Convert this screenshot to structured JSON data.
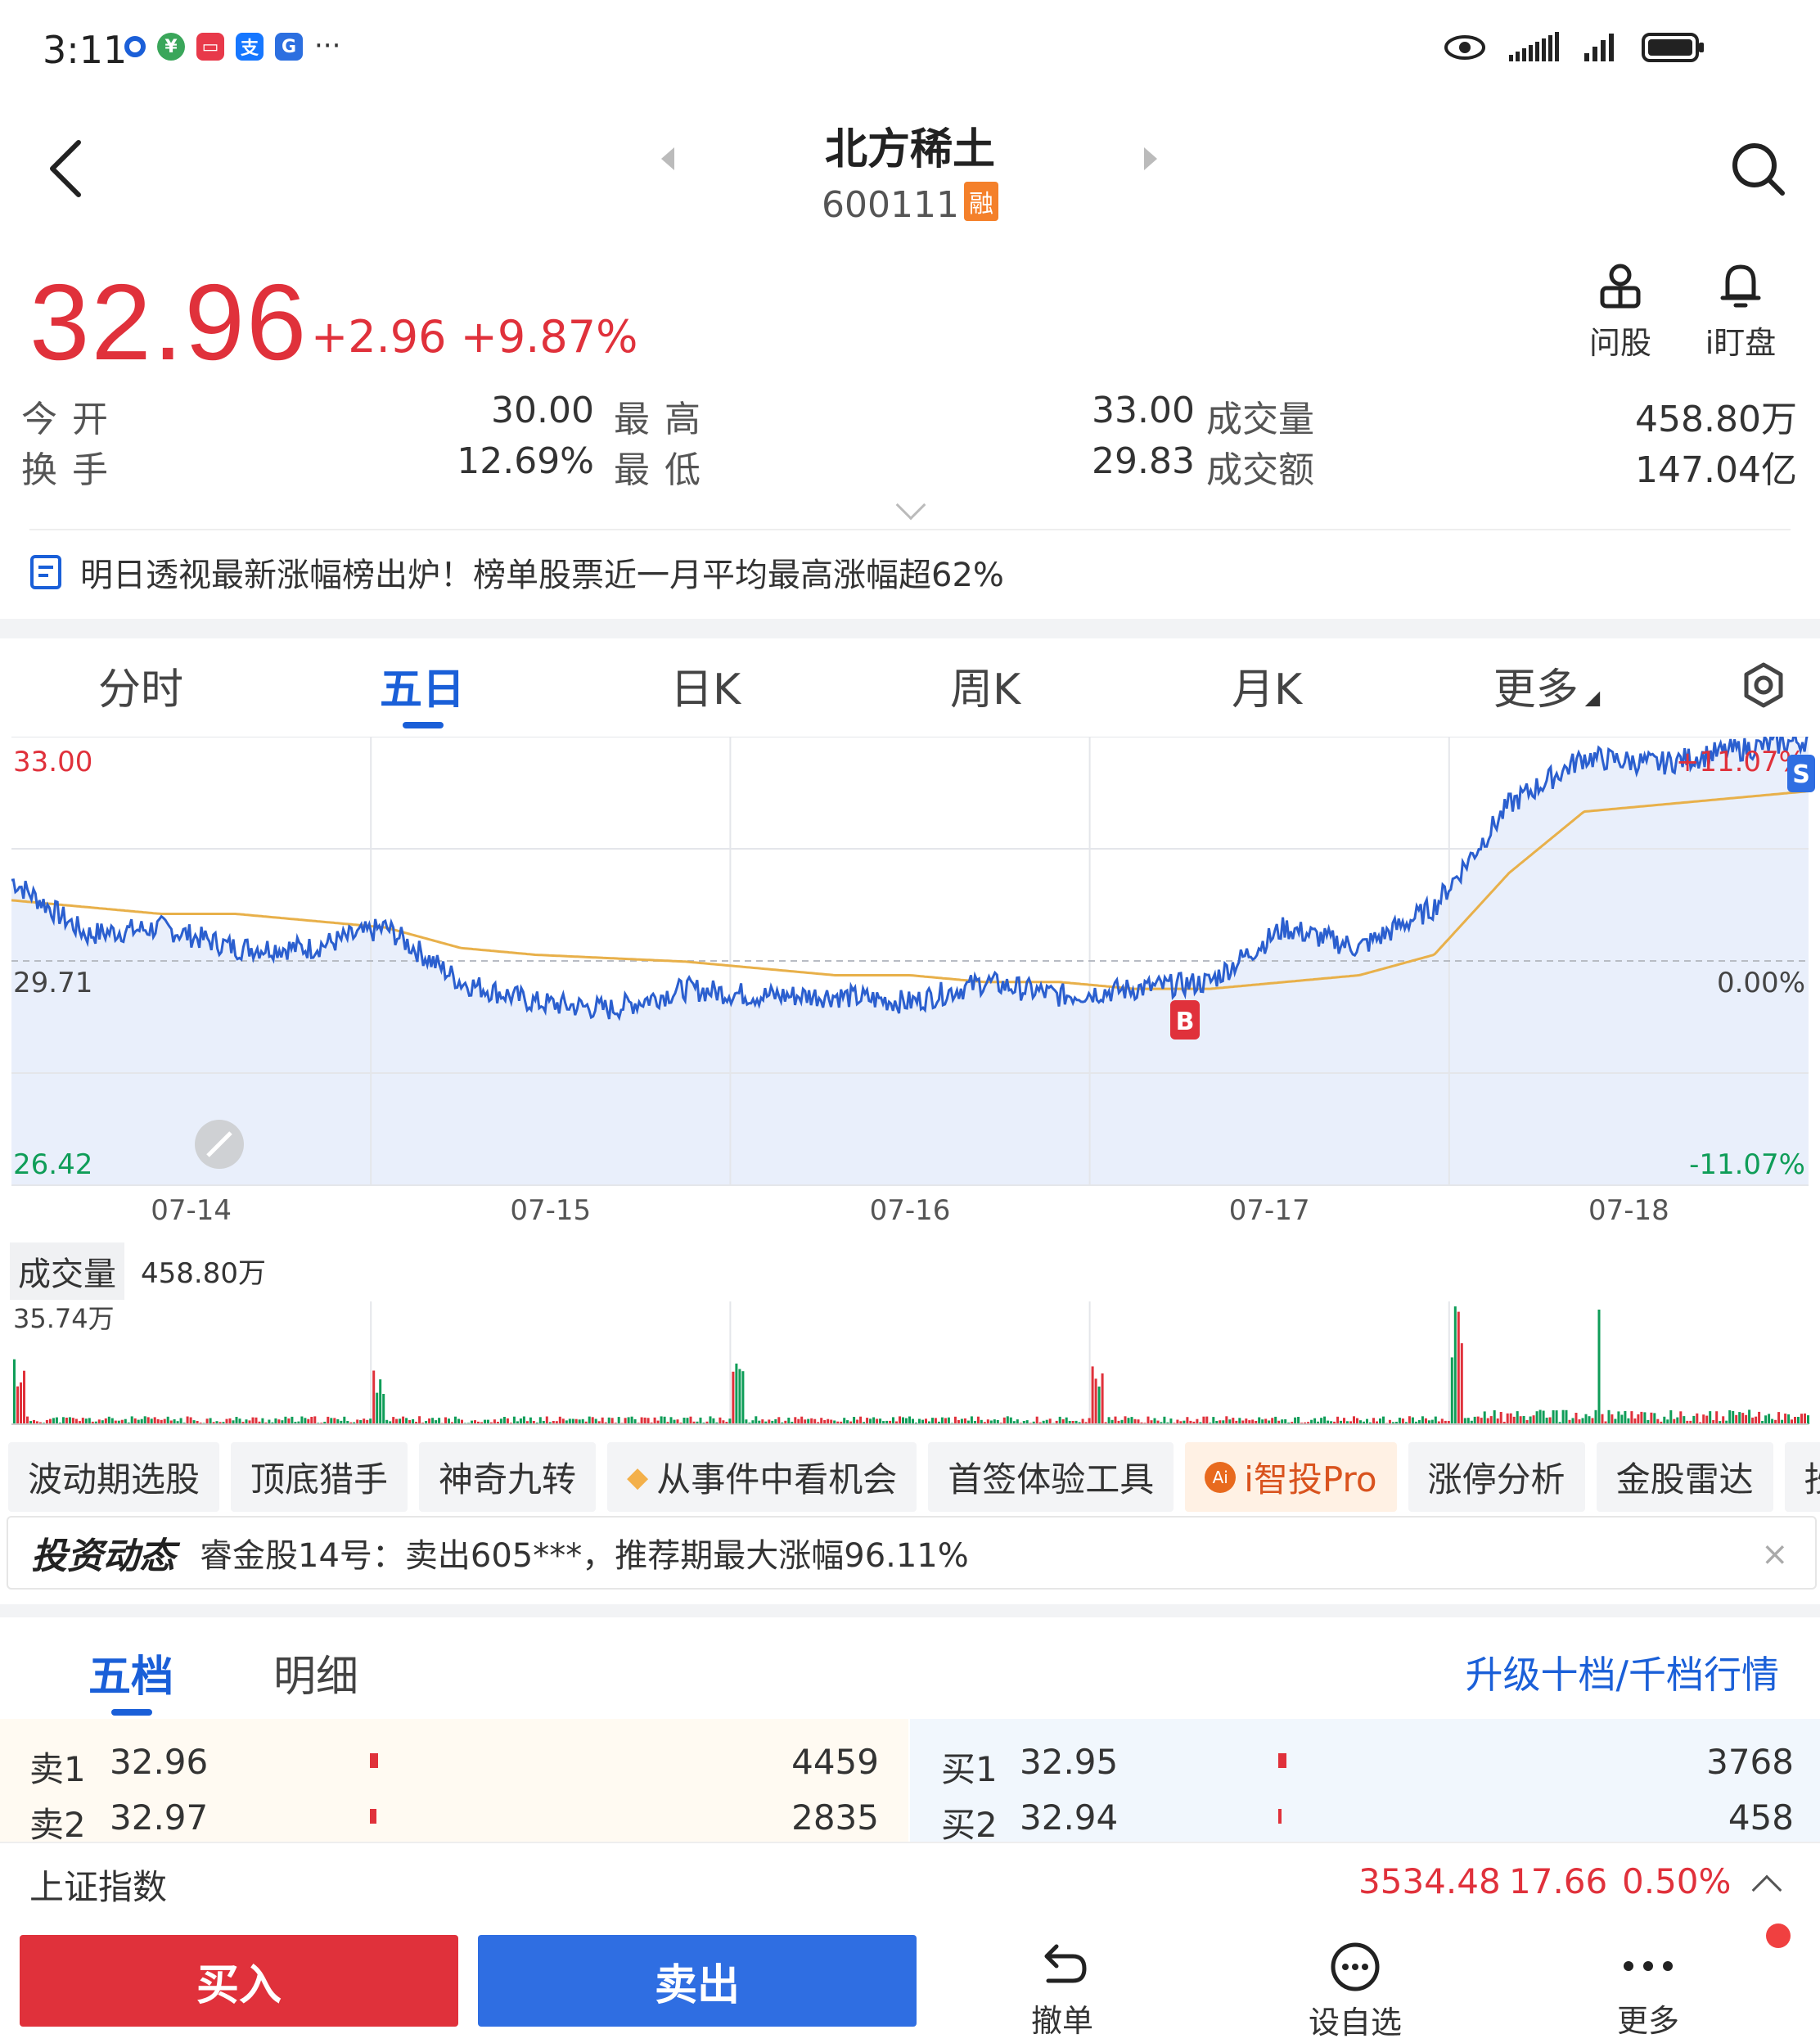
{
  "status_bar": {
    "time": "3:11",
    "more_glyph": "···",
    "app_icons": [
      "browser-icon",
      "bank-icon",
      "message-icon",
      "alipay-icon",
      "finance-icon"
    ],
    "right_icons": [
      "eye-icon",
      "signal-icon",
      "signal-icon",
      "battery-icon"
    ]
  },
  "header": {
    "title": "北方稀土",
    "code": "600111",
    "badge": "融"
  },
  "quote": {
    "price": "32.96",
    "change": "+2.96  +9.87%",
    "ask_label": "问股",
    "watch_label": "i盯盘"
  },
  "stats": [
    {
      "label": "今开",
      "value": "30.00",
      "label2": "最高",
      "value2": "33.00",
      "label3": "成交量",
      "value3": "458.80万"
    },
    {
      "label": "换手",
      "value": "12.69%",
      "label2": "最低",
      "value2": "29.83",
      "label3": "成交额",
      "value3": "147.04亿"
    }
  ],
  "news": {
    "text": "明日透视最新涨幅榜出炉！榜单股票近一月平均最高涨幅超62%"
  },
  "chart_tabs": [
    "分时",
    "五日",
    "日K",
    "周K",
    "月K",
    "更多"
  ],
  "active_chart_tab": "五日",
  "chart_data": {
    "type": "line",
    "x": [
      "07-14",
      "07-15",
      "07-16",
      "07-17",
      "07-18"
    ],
    "ylim": [
      26.42,
      33.0
    ],
    "prev_close": 29.71,
    "y_labels_left": [
      "33.00",
      "29.71",
      "26.42"
    ],
    "y_labels_right": [
      "+11.07%",
      "0.00%",
      "-11.07%"
    ],
    "series": [
      {
        "values": [
          30.9,
          30.1,
          30.2,
          29.9,
          29.9,
          30.2,
          29.4,
          29.1,
          29.0,
          29.3,
          29.2,
          29.2,
          29.1,
          29.4,
          29.2,
          29.3,
          29.4,
          30.2,
          29.9,
          30.5,
          32.0,
          32.7,
          32.6,
          32.8,
          32.96
        ]
      },
      {
        "values": [
          30.6,
          30.5,
          30.4,
          30.4,
          30.3,
          30.2,
          29.9,
          29.8,
          29.75,
          29.7,
          29.6,
          29.5,
          29.5,
          29.4,
          29.4,
          29.3,
          29.3,
          29.4,
          29.5,
          29.8,
          31.0,
          31.9,
          32.0,
          32.1,
          32.2
        ]
      }
    ],
    "markers": [
      {
        "label": "B",
        "day": "07-17"
      },
      {
        "label": "S",
        "day": "07-18"
      }
    ],
    "volume": {
      "label": "成交量",
      "total": "458.80万",
      "max_label": "35.74万",
      "max": 35.74
    }
  },
  "tools": [
    "波动期选股",
    "顶底猎手",
    "神奇九转",
    "从事件中看机会",
    "首签体验工具",
    "i智投Pro",
    "涨停分析",
    "金股雷达",
    "抄底"
  ],
  "invest_news": {
    "brand": "投资动态",
    "text": "睿金股14号：卖出605***，推荐期最大涨幅96.11%",
    "close": "×"
  },
  "order_book": {
    "tabs": [
      "五档",
      "明细"
    ],
    "upgrade": "升级十档/千档行情",
    "sell": [
      {
        "label": "卖1",
        "price": "32.96",
        "volume": "4459"
      },
      {
        "label": "卖2",
        "price": "32.97",
        "volume": "2835"
      }
    ],
    "buy": [
      {
        "label": "买1",
        "price": "32.95",
        "volume": "3768"
      },
      {
        "label": "买2",
        "price": "32.94",
        "volume": "458"
      }
    ]
  },
  "index": {
    "name": "上证指数",
    "value": "3534.48",
    "change": "17.66",
    "percent": "0.50%"
  },
  "actions": {
    "buy": "买入",
    "sell": "卖出",
    "cancel": "撤单",
    "watchlist": "设自选",
    "more": "更多"
  },
  "colors": {
    "up": "#e0313b",
    "down": "#0f9d58",
    "accent": "#1a5fd8",
    "sell_button": "#2f6ee2",
    "price_line": "#2b5fcf",
    "avg_line": "#e8b04a",
    "chart_fill": "#e9effb"
  }
}
